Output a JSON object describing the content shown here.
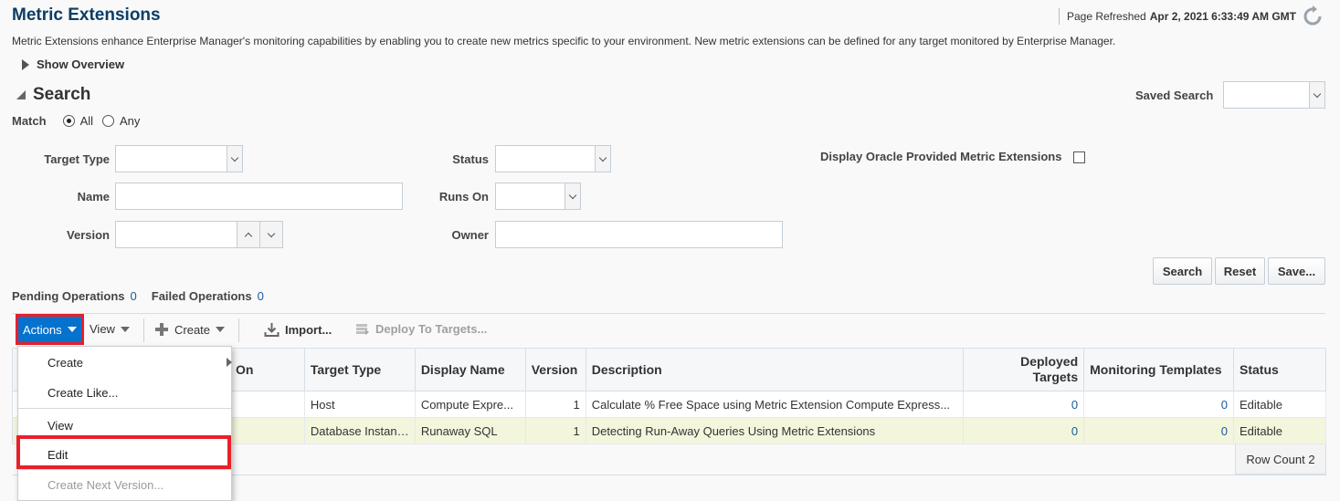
{
  "page": {
    "title": "Metric Extensions",
    "refreshed_label": "Page Refreshed",
    "refreshed_value": "Apr 2, 2021 6:33:49 AM GMT",
    "intro": "Metric Extensions enhance Enterprise Manager's monitoring capabilities by enabling you to create new metrics specific to your environment. New metric extensions can be defined for any target monitored by Enterprise Manager.",
    "show_overview": "Show Overview"
  },
  "search": {
    "heading": "Search",
    "saved_search_label": "Saved Search",
    "match_label": "Match",
    "match_all": "All",
    "match_any": "Any",
    "target_type_label": "Target Type",
    "name_label": "Name",
    "version_label": "Version",
    "status_label": "Status",
    "runs_on_label": "Runs On",
    "owner_label": "Owner",
    "display_oracle_label": "Display Oracle Provided Metric Extensions",
    "search_btn": "Search",
    "reset_btn": "Reset",
    "save_btn": "Save..."
  },
  "ops": {
    "pending_label": "Pending Operations",
    "pending_count": "0",
    "failed_label": "Failed Operations",
    "failed_count": "0"
  },
  "toolbar": {
    "actions": "Actions",
    "view": "View",
    "create": "Create",
    "import": "Import...",
    "deploy": "Deploy To Targets..."
  },
  "table": {
    "headers": {
      "on": "On",
      "target_type": "Target Type",
      "display_name": "Display Name",
      "version": "Version",
      "description": "Description",
      "deployed_1": "Deployed",
      "deployed_2": "Targets",
      "templates": "Monitoring Templates",
      "status": "Status"
    },
    "rows": [
      {
        "on": "",
        "target_type": "Host",
        "display_name": "Compute Expre...",
        "version": "1",
        "description": "Calculate % Free Space using Metric Extension Compute Express...",
        "deployed": "0",
        "templates": "0",
        "status": "Editable"
      },
      {
        "on": "",
        "target_type": "Database Instance",
        "display_name": "Runaway SQL",
        "version": "1",
        "description": "Detecting Run-Away Queries Using Metric Extensions",
        "deployed": "0",
        "templates": "0",
        "status": "Editable"
      }
    ],
    "row_count": "Row Count 2"
  },
  "menu": {
    "create": "Create",
    "create_like": "Create Like...",
    "view": "View",
    "edit": "Edit",
    "create_next": "Create Next Version..."
  },
  "colors": {
    "accent": "#0572ce",
    "highlight": "#e8202a",
    "title": "#0b3d66",
    "link": "#145c9e"
  }
}
